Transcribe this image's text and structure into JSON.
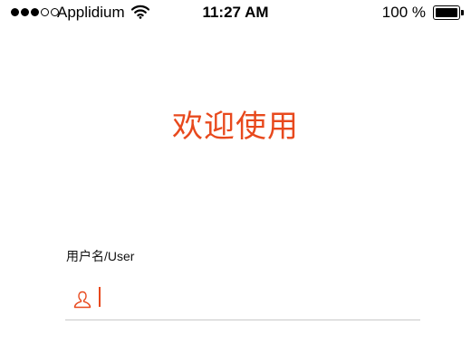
{
  "status_bar": {
    "carrier": "Applidium",
    "time": "11:27 AM",
    "battery_percent": "100 %",
    "signal_bars_filled": 3,
    "signal_bars_total": 5,
    "battery_level": 1.0,
    "icons": [
      "signal-dots-icon",
      "wifi-icon",
      "battery-icon"
    ]
  },
  "main": {
    "welcome_title": "欢迎使用",
    "username_label": "用户名/User",
    "username_value": "",
    "username_icon": "user-icon"
  },
  "colors": {
    "accent": "#e8491d",
    "underline": "#c8c8c8",
    "text": "#000000",
    "background": "#ffffff"
  }
}
